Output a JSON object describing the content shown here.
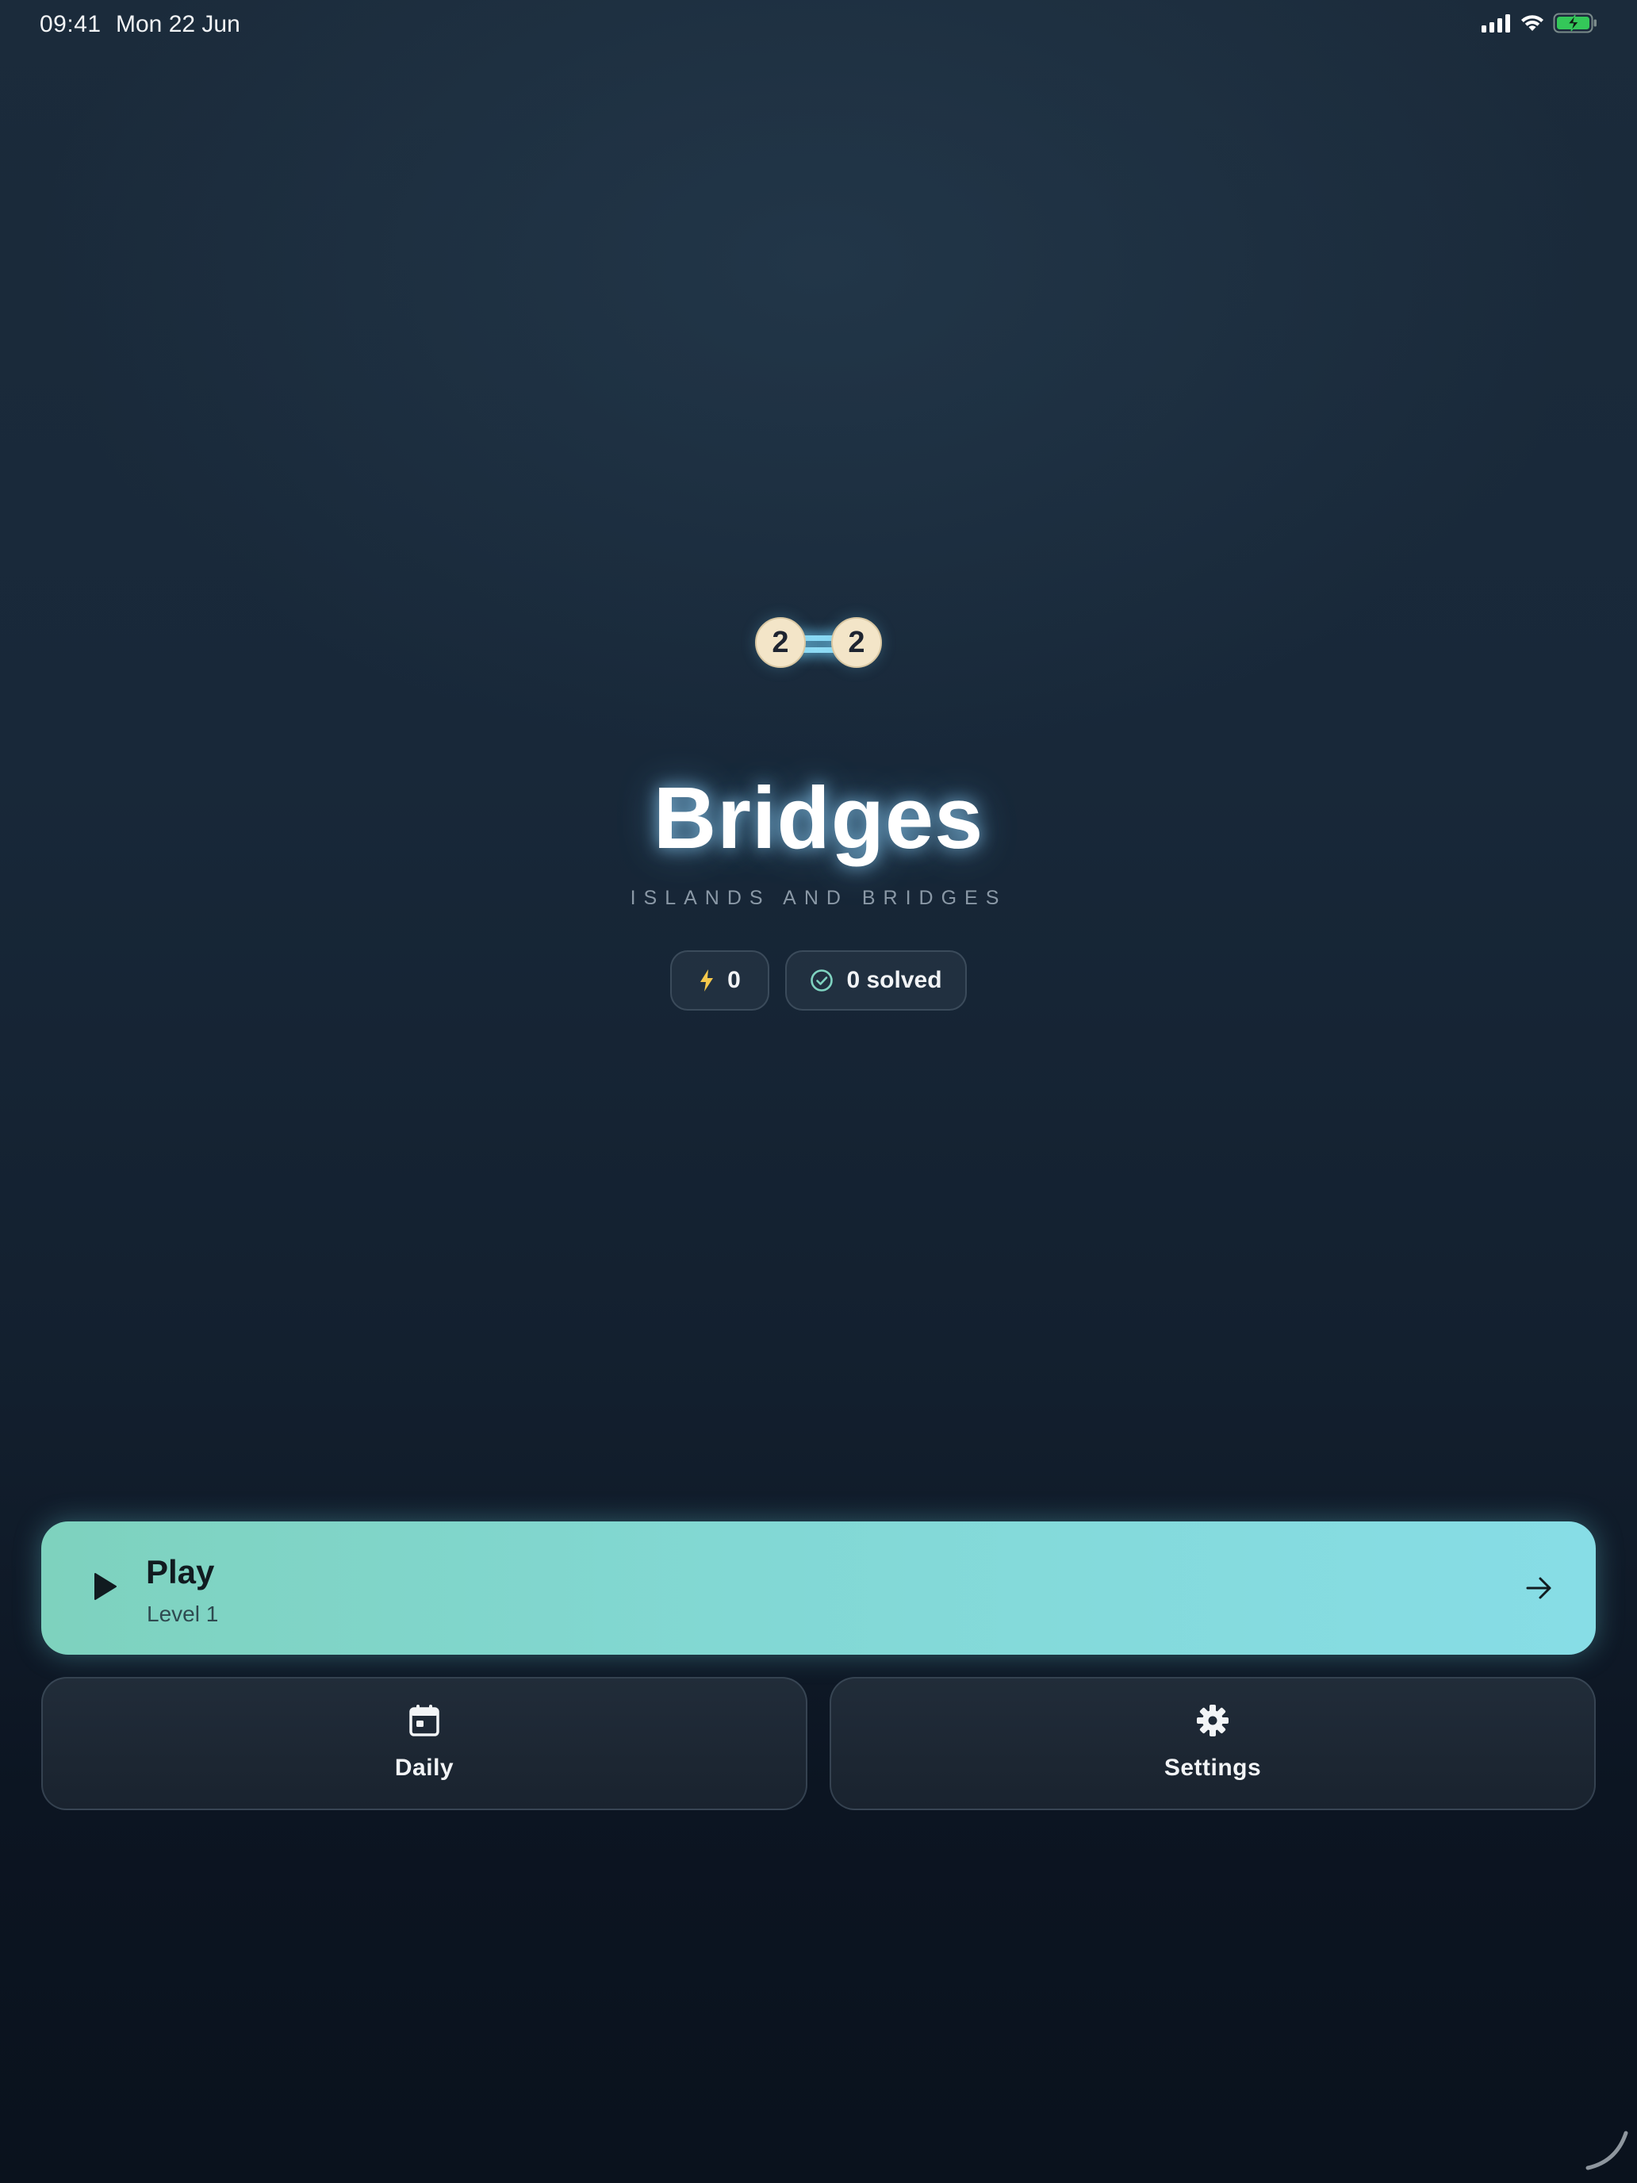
{
  "status_bar": {
    "time": "09:41",
    "date": "Mon 22 Jun",
    "icons": [
      "cellular-signal-icon",
      "wifi-icon",
      "battery-charging-icon"
    ],
    "battery_color": "#34c759"
  },
  "logo": {
    "left_island": "2",
    "right_island": "2",
    "island_color": "#f3e5c8",
    "bridge_color": "#8fdcf5"
  },
  "title": "Bridges",
  "subtitle": "ISLANDS AND BRIDGES",
  "stats": {
    "streak": {
      "icon": "lightning-icon",
      "value": "0",
      "icon_color": "#f5c84c"
    },
    "solved": {
      "icon": "check-circle-icon",
      "value": "0 solved",
      "icon_color": "#7fd3c0"
    }
  },
  "play": {
    "title": "Play",
    "subtitle": "Level 1",
    "icon": "play-icon",
    "arrow_icon": "arrow-right-icon",
    "gradient": [
      "#7ed2be",
      "#87dde6"
    ]
  },
  "daily": {
    "label": "Daily",
    "icon": "calendar-icon"
  },
  "settings": {
    "label": "Settings",
    "icon": "gear-icon"
  }
}
